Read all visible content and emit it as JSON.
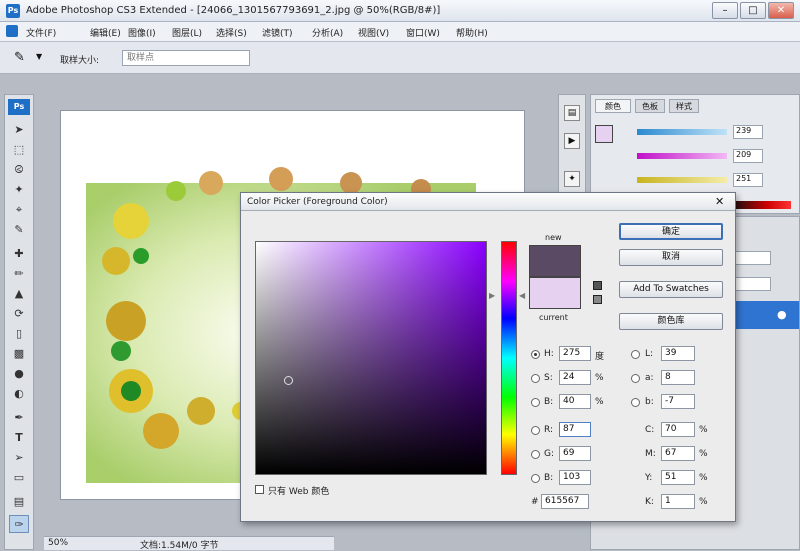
{
  "window": {
    "title": "Adobe Photoshop CS3 Extended - [24066_1301567793691_2.jpg @ 50%(RGB/8#)]",
    "app_logo": "Ps"
  },
  "menu": [
    "文件(F)",
    "编辑(E)",
    "图像(I)",
    "图层(L)",
    "选择(S)",
    "滤镜(T)",
    "分析(A)",
    "视图(V)",
    "窗口(W)",
    "帮助(H)"
  ],
  "options_bar": {
    "sample_size_label": "取样大小:",
    "sample_size_value": "取样点"
  },
  "right_panel": {
    "tabs": [
      "颜色",
      "色板",
      "样式"
    ],
    "slider_values": [
      "239",
      "209",
      "251"
    ]
  },
  "status_bar": {
    "zoom": "50%",
    "doc_size": "文档:1.54M/0 字节"
  },
  "color_picker": {
    "title": "Color Picker (Foreground Color)",
    "new_label": "new",
    "current_label": "current",
    "new_color": "#5b4a63",
    "current_color": "#e7d1f0",
    "buttons": {
      "ok": "确定",
      "cancel": "取消",
      "add_swatches": "Add To Swatches",
      "color_libraries": "颜色库"
    },
    "web_only_label": "只有 Web 颜色",
    "hsb": [
      {
        "label": "H:",
        "value": "275",
        "unit": "度"
      },
      {
        "label": "S:",
        "value": "24",
        "unit": "%"
      },
      {
        "label": "B:",
        "value": "40",
        "unit": "%"
      }
    ],
    "rgb": [
      {
        "label": "R:",
        "value": "87"
      },
      {
        "label": "G:",
        "value": "69"
      },
      {
        "label": "B:",
        "value": "103"
      }
    ],
    "lab": [
      {
        "label": "L:",
        "value": "39"
      },
      {
        "label": "a:",
        "value": "8"
      },
      {
        "label": "b:",
        "value": "-7"
      }
    ],
    "cmyk": [
      {
        "label": "C:",
        "value": "70",
        "unit": "%"
      },
      {
        "label": "M:",
        "value": "67",
        "unit": "%"
      },
      {
        "label": "Y:",
        "value": "51",
        "unit": "%"
      },
      {
        "label": "K:",
        "value": "1",
        "unit": "%"
      }
    ],
    "hex_label": "#",
    "hex": "615567"
  },
  "colors": {
    "accent": "#1f6fc6",
    "selection_blue": "#2f74d0"
  }
}
